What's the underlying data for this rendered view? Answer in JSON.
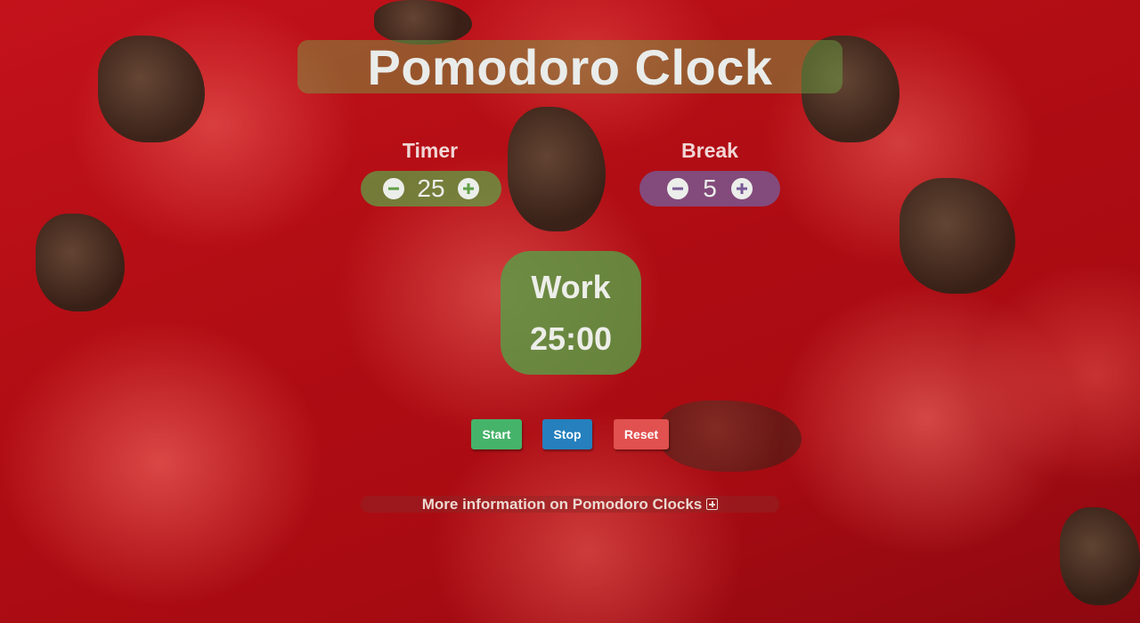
{
  "header": {
    "title": "Pomodoro Clock"
  },
  "settings": {
    "timer": {
      "label": "Timer",
      "value": "25",
      "decrement_icon": "minus-circle-icon",
      "increment_icon": "plus-circle-icon"
    },
    "break": {
      "label": "Break",
      "value": "5",
      "decrement_icon": "minus-circle-icon",
      "increment_icon": "plus-circle-icon"
    }
  },
  "display": {
    "mode": "Work",
    "time": "25:00"
  },
  "controls": {
    "start_label": "Start",
    "stop_label": "Stop",
    "reset_label": "Reset"
  },
  "info": {
    "text": "More information on Pomodoro Clocks",
    "icon": "plus-square-icon"
  },
  "colors": {
    "start": "#46b36a",
    "stop": "#2580bd",
    "reset": "#e0514f",
    "timer_pill": "#5fa046",
    "break_pill": "#785a96"
  },
  "background": "tomatoes-photo"
}
